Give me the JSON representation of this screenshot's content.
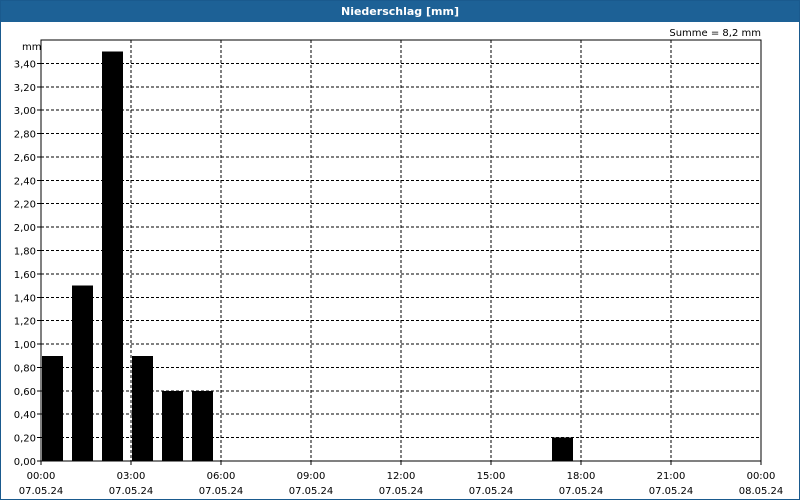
{
  "header": {
    "title": "Niederschlag [mm]"
  },
  "summary": "Summe = 8,2 mm",
  "chart_data": {
    "type": "bar",
    "title": "Niederschlag [mm]",
    "ylabel": "mm",
    "xlabel": "",
    "ylim": [
      0,
      3.6
    ],
    "xlim_hours": [
      0,
      24
    ],
    "y_ticks": [
      "0,00",
      "0,20",
      "0,40",
      "0,60",
      "0,80",
      "1,00",
      "1,20",
      "1,40",
      "1,60",
      "1,80",
      "2,00",
      "2,20",
      "2,40",
      "2,60",
      "2,80",
      "3,00",
      "3,20",
      "3,40"
    ],
    "x_ticks": [
      {
        "time": "00:00",
        "date": "07.05.24"
      },
      {
        "time": "03:00",
        "date": "07.05.24"
      },
      {
        "time": "06:00",
        "date": "07.05.24"
      },
      {
        "time": "09:00",
        "date": "07.05.24"
      },
      {
        "time": "12:00",
        "date": "07.05.24"
      },
      {
        "time": "15:00",
        "date": "07.05.24"
      },
      {
        "time": "18:00",
        "date": "07.05.24"
      },
      {
        "time": "21:00",
        "date": "07.05.24"
      },
      {
        "time": "00:00",
        "date": "08.05.24"
      }
    ],
    "categories": [
      "00:00",
      "01:00",
      "02:00",
      "03:00",
      "04:00",
      "05:00",
      "06:00",
      "07:00",
      "08:00",
      "09:00",
      "10:00",
      "11:00",
      "12:00",
      "13:00",
      "14:00",
      "15:00",
      "16:00",
      "17:00",
      "18:00",
      "19:00",
      "20:00",
      "21:00",
      "22:00",
      "23:00"
    ],
    "values": [
      0.9,
      1.5,
      3.5,
      0.9,
      0.6,
      0.6,
      0,
      0,
      0,
      0,
      0,
      0,
      0,
      0,
      0,
      0,
      0,
      0.2,
      0,
      0,
      0,
      0,
      0,
      0
    ],
    "grid": true,
    "colors": {
      "bar": "#000000",
      "title_bar": "#1d6196",
      "grid": "#000000"
    }
  }
}
